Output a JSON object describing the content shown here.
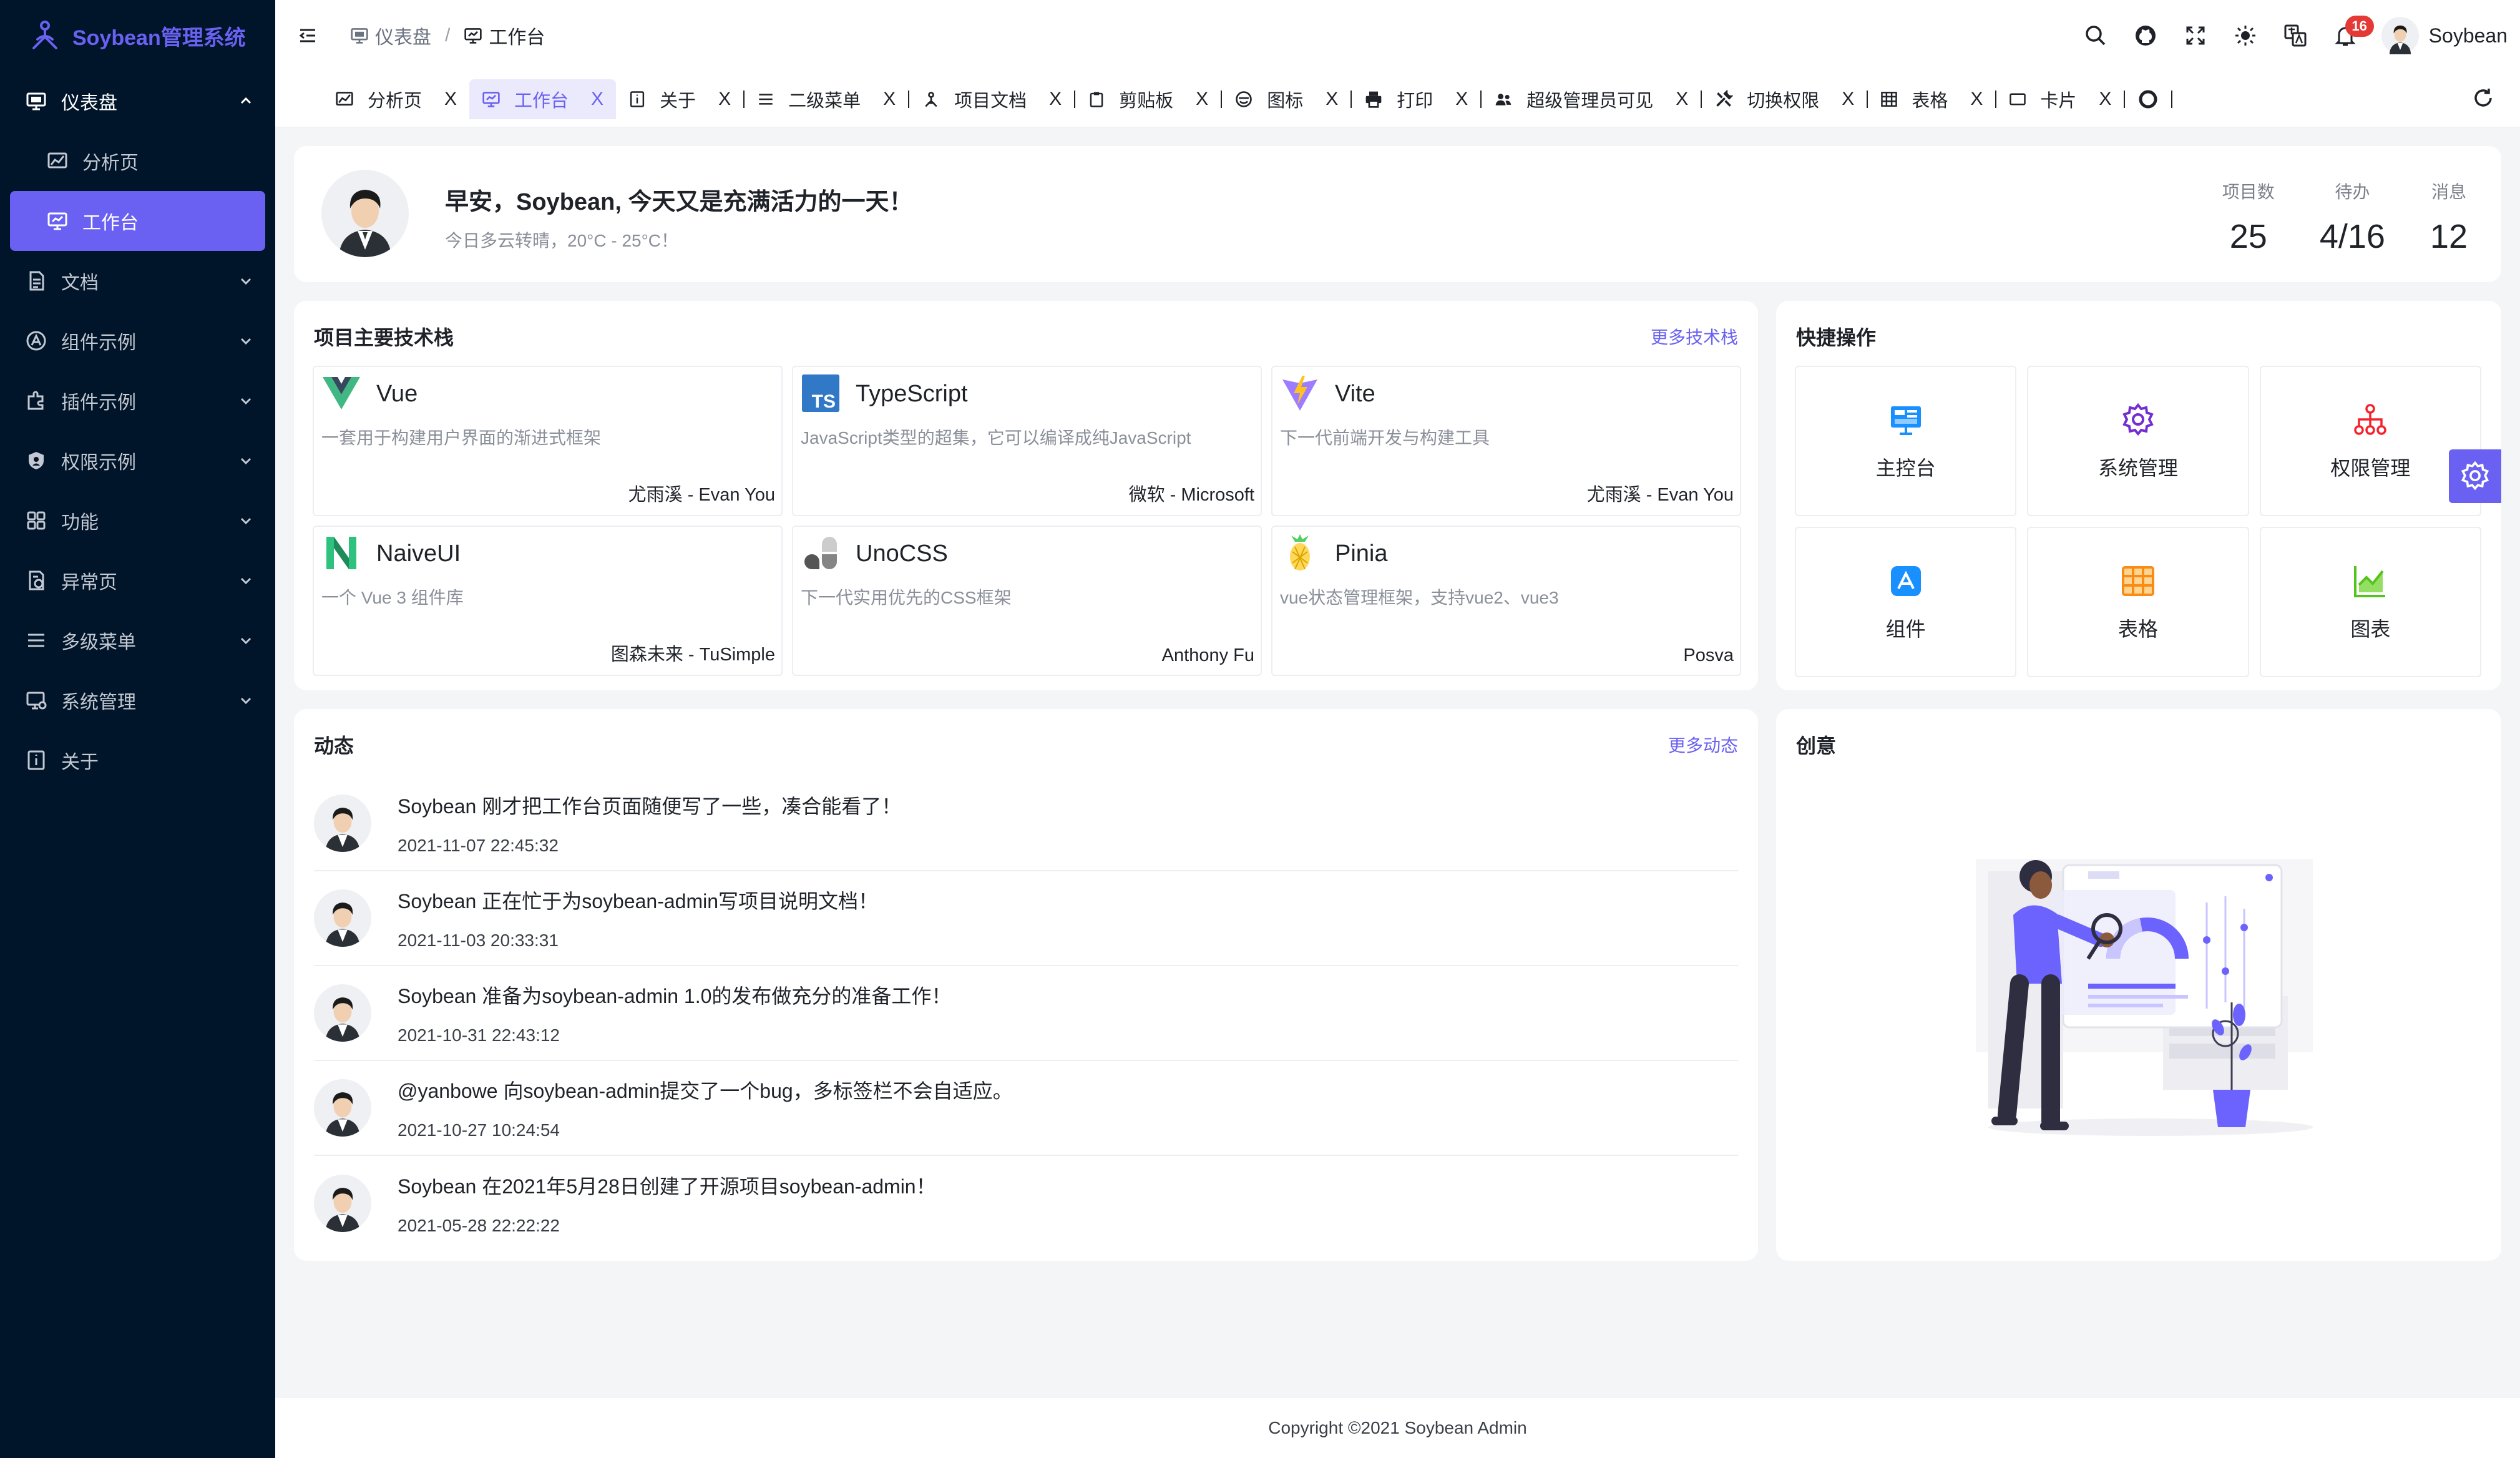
{
  "app": {
    "title": "Soybean管理系统",
    "accent": "#6a61f2",
    "sidebar_bg": "#001529"
  },
  "sidebar": {
    "items": [
      {
        "label": "仪表盘",
        "icon": "dashboard-icon",
        "expanded": true,
        "children": [
          {
            "label": "分析页",
            "icon": "analysis-icon",
            "active": false
          },
          {
            "label": "工作台",
            "icon": "workbench-icon",
            "active": true
          }
        ]
      },
      {
        "label": "文档",
        "icon": "document-icon"
      },
      {
        "label": "组件示例",
        "icon": "component-icon"
      },
      {
        "label": "插件示例",
        "icon": "plugin-icon"
      },
      {
        "label": "权限示例",
        "icon": "shield-icon"
      },
      {
        "label": "功能",
        "icon": "grid-icon"
      },
      {
        "label": "异常页",
        "icon": "exception-icon"
      },
      {
        "label": "多级菜单",
        "icon": "menu-icon"
      },
      {
        "label": "系统管理",
        "icon": "system-icon"
      },
      {
        "label": "关于",
        "icon": "info-icon"
      }
    ]
  },
  "header": {
    "breadcrumb": [
      {
        "label": "仪表盘",
        "icon": "dashboard-icon"
      },
      {
        "label": "工作台",
        "icon": "workbench-icon"
      }
    ],
    "breadcrumb_sep": "/",
    "notification_count": "16",
    "user_name": "Soybean"
  },
  "tabs": [
    {
      "label": "分析页",
      "icon": "analysis-icon",
      "active": false
    },
    {
      "label": "工作台",
      "icon": "workbench-icon",
      "active": true
    },
    {
      "label": "关于",
      "icon": "info-icon",
      "active": false
    },
    {
      "label": "二级菜单",
      "icon": "menu-icon",
      "active": false
    },
    {
      "label": "项目文档",
      "icon": "doc-icon",
      "active": false
    },
    {
      "label": "剪贴板",
      "icon": "clipboard-icon",
      "active": false
    },
    {
      "label": "图标",
      "icon": "icon-icon",
      "active": false
    },
    {
      "label": "打印",
      "icon": "print-icon",
      "active": false
    },
    {
      "label": "超级管理员可见",
      "icon": "admin-icon",
      "active": false
    },
    {
      "label": "切换权限",
      "icon": "tools-icon",
      "active": false
    },
    {
      "label": "表格",
      "icon": "table-icon",
      "active": false
    },
    {
      "label": "卡片",
      "icon": "card-icon",
      "active": false
    }
  ],
  "tab_close": "X",
  "welcome": {
    "greeting": "早安，Soybean, 今天又是充满活力的一天！",
    "weather": "今日多云转晴，20°C - 25°C！",
    "stats": [
      {
        "label": "项目数",
        "value": "25"
      },
      {
        "label": "待办",
        "value": "4/16"
      },
      {
        "label": "消息",
        "value": "12"
      }
    ]
  },
  "techstack": {
    "title": "项目主要技术栈",
    "more": "更多技术栈",
    "items": [
      {
        "name": "Vue",
        "desc": "一套用于构建用户界面的渐进式框架",
        "author": "尤雨溪 - Evan You",
        "logo": "vue-logo"
      },
      {
        "name": "TypeScript",
        "desc": "JavaScript类型的超集，它可以编译成纯JavaScript",
        "author": "微软 - Microsoft",
        "logo": "typescript-logo"
      },
      {
        "name": "Vite",
        "desc": "下一代前端开发与构建工具",
        "author": "尤雨溪 - Evan You",
        "logo": "vite-logo"
      },
      {
        "name": "NaiveUI",
        "desc": "一个 Vue 3 组件库",
        "author": "图森未来 - TuSimple",
        "logo": "naiveui-logo"
      },
      {
        "name": "UnoCSS",
        "desc": "下一代实用优先的CSS框架",
        "author": "Anthony Fu",
        "logo": "unocss-logo"
      },
      {
        "name": "Pinia",
        "desc": "vue状态管理框架，支持vue2、vue3",
        "author": "Posva",
        "logo": "pinia-logo"
      }
    ]
  },
  "quick": {
    "title": "快捷操作",
    "items": [
      {
        "label": "主控台",
        "icon": "monitor-icon",
        "color": "#1890ff"
      },
      {
        "label": "系统管理",
        "icon": "gear-icon",
        "color": "#722ed1"
      },
      {
        "label": "权限管理",
        "icon": "hierarchy-icon",
        "color": "#f5222d"
      },
      {
        "label": "组件",
        "icon": "appstore-icon",
        "color": "#1890ff"
      },
      {
        "label": "表格",
        "icon": "table-icon",
        "color": "#fa8c16"
      },
      {
        "label": "图表",
        "icon": "chart-icon",
        "color": "#52c41a"
      }
    ]
  },
  "activity": {
    "title": "动态",
    "more": "更多动态",
    "items": [
      {
        "text": "Soybean 刚才把工作台页面随便写了一些，凑合能看了！",
        "time": "2021-11-07 22:45:32"
      },
      {
        "text": "Soybean 正在忙于为soybean-admin写项目说明文档！",
        "time": "2021-11-03 20:33:31"
      },
      {
        "text": "Soybean 准备为soybean-admin 1.0的发布做充分的准备工作！",
        "time": "2021-10-31 22:43:12"
      },
      {
        "text": "@yanbowe 向soybean-admin提交了一个bug，多标签栏不会自适应。",
        "time": "2021-10-27 10:24:54"
      },
      {
        "text": "Soybean 在2021年5月28日创建了开源项目soybean-admin！",
        "time": "2021-05-28 22:22:22"
      }
    ]
  },
  "creative": {
    "title": "创意"
  },
  "footer": {
    "copyright": "Copyright ©2021 Soybean Admin"
  }
}
